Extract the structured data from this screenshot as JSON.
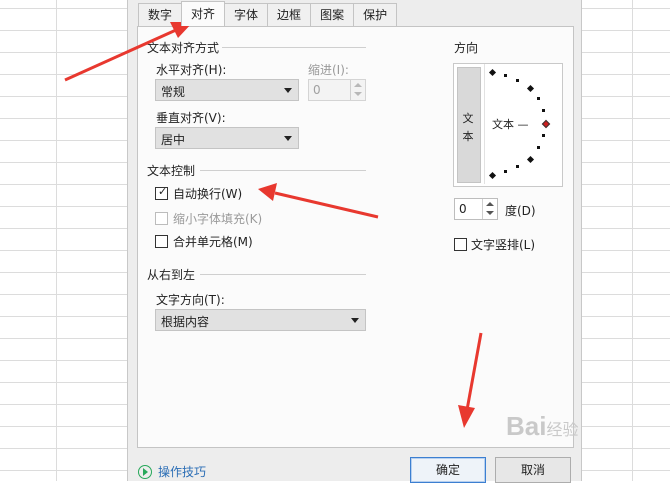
{
  "tabs": [
    {
      "label": "数字"
    },
    {
      "label": "对齐"
    },
    {
      "label": "字体"
    },
    {
      "label": "边框"
    },
    {
      "label": "图案"
    },
    {
      "label": "保护"
    }
  ],
  "active_tab": "对齐",
  "text_alignment": {
    "section_title": "文本对齐方式",
    "horizontal_label": "水平对齐(H):",
    "horizontal_value": "常规",
    "indent_label": "缩进(I):",
    "indent_value": "0",
    "vertical_label": "垂直对齐(V):",
    "vertical_value": "居中"
  },
  "text_control": {
    "section_title": "文本控制",
    "wrap_label": "自动换行(W)",
    "wrap_checked": true,
    "shrink_label": "缩小字体填充(K)",
    "shrink_checked": false,
    "merge_label": "合并单元格(M)",
    "merge_checked": false
  },
  "rtl": {
    "section_title": "从右到左",
    "direction_label": "文字方向(T):",
    "direction_value": "根据内容"
  },
  "orientation": {
    "section_title": "方向",
    "vertical_text_chars": [
      "文",
      "本"
    ],
    "preview_text": "文本 —",
    "degree_value": "0",
    "degree_label": "度(D)",
    "vertical_text_checkbox_label": "文字竖排(L)",
    "vertical_text_checked": false
  },
  "footer": {
    "tips_label": "操作技巧",
    "ok_label": "确定",
    "cancel_label": "取消"
  },
  "watermark": {
    "text": "Bai",
    "suffix": "经验"
  },
  "colors": {
    "arrow": "#e8382f",
    "active_dot": "#cc1f1f",
    "link": "#2a6db5"
  }
}
